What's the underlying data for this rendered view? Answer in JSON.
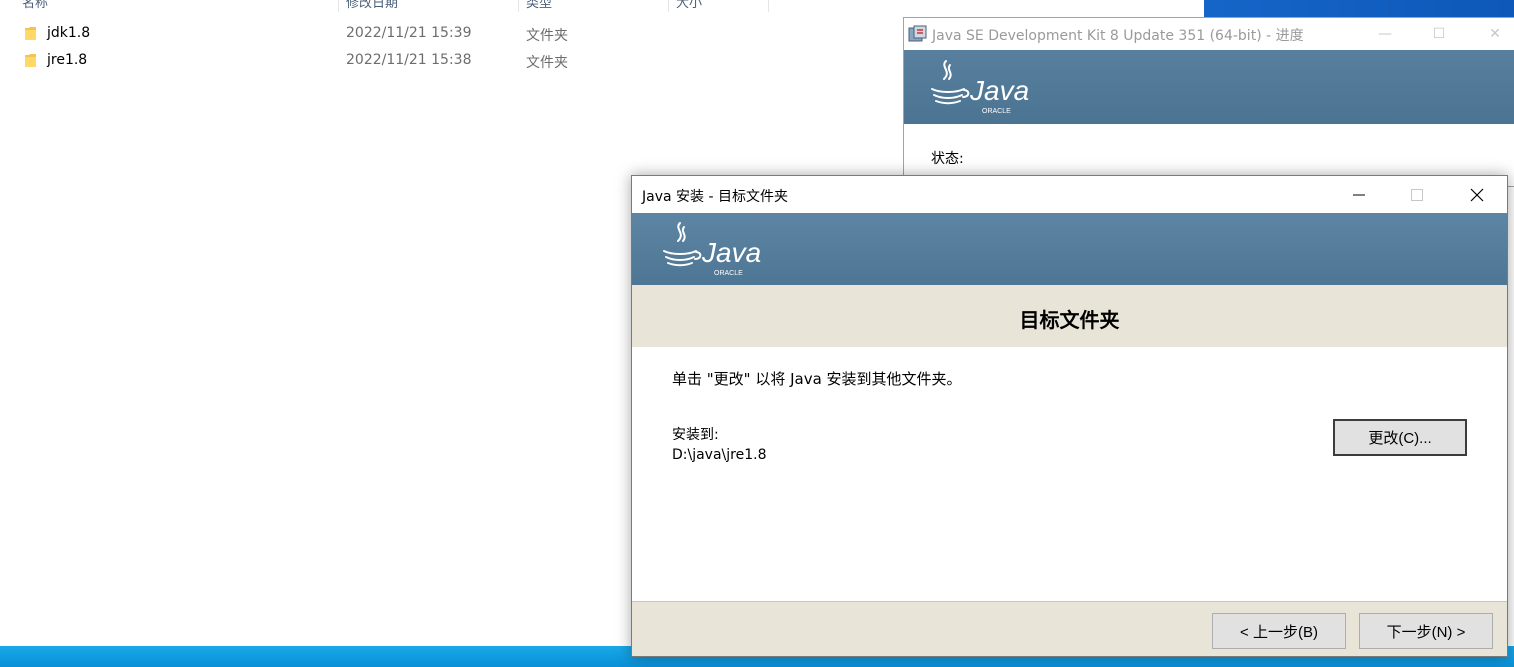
{
  "explorer": {
    "columns": [
      "名称",
      "修改日期",
      "类型",
      "大小"
    ],
    "files": [
      {
        "name": "jdk1.8",
        "date": "2022/11/21 15:39",
        "type": "文件夹"
      },
      {
        "name": "jre1.8",
        "date": "2022/11/21 15:38",
        "type": "文件夹"
      }
    ]
  },
  "back_window": {
    "title": "Java SE Development Kit 8 Update 351 (64-bit) - 进度",
    "brand": "Java",
    "vendor": "ORACLE",
    "status_label": "状态:"
  },
  "dialog": {
    "title": "Java 安装 - 目标文件夹",
    "brand": "Java",
    "vendor": "ORACLE",
    "heading": "目标文件夹",
    "instruction": "单击 \"更改\" 以将 Java 安装到其他文件夹。",
    "install_label": "安装到:",
    "install_path": "D:\\java\\jre1.8",
    "change_button": "更改(C)...",
    "back_button": "< 上一步(B)",
    "next_button": "下一步(N) >"
  },
  "colors": {
    "banner": "#4d7594",
    "footer": "#e8e4d7",
    "folder": "#f3c44e"
  },
  "icons": [
    "folder-icon",
    "java-cup-icon",
    "minimize-icon",
    "maximize-icon",
    "close-icon"
  ]
}
